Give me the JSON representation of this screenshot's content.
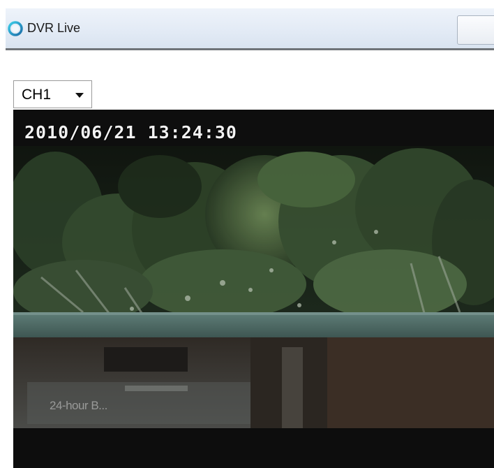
{
  "window": {
    "title": "DVR Live",
    "icon": "dvr-ring-icon"
  },
  "channel_select": {
    "selected": "CH1",
    "icon": "chevron-down-icon"
  },
  "video": {
    "timestamp": "2010/06/21 13:24:30",
    "overlay_caption": "24-hour B..."
  },
  "colors": {
    "titlebar_bg": "#e2eaf5",
    "titlebar_border": "#6f7378",
    "video_bg": "#0c0c0c",
    "timestamp_text": "#f2f2f2"
  }
}
